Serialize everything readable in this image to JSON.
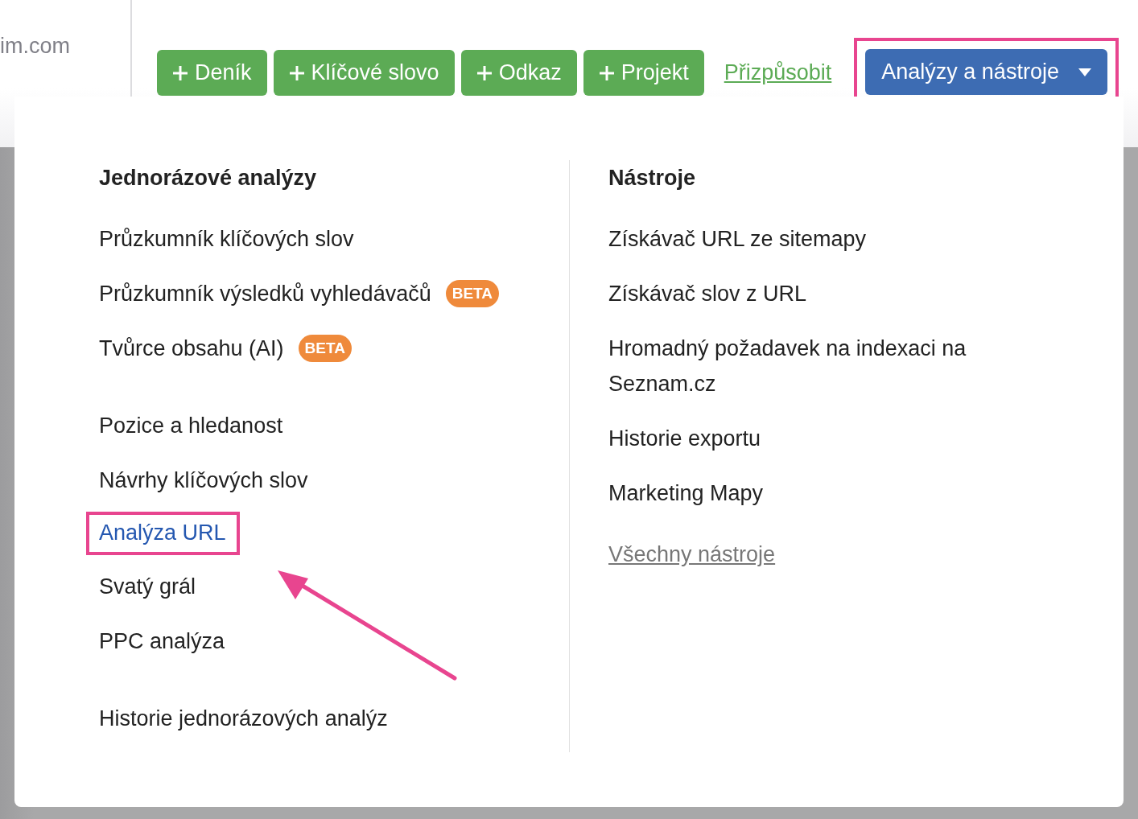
{
  "header": {
    "site_fragment": "im.com",
    "buttons": [
      {
        "label": "Deník"
      },
      {
        "label": "Klíčové slovo"
      },
      {
        "label": "Odkaz"
      },
      {
        "label": "Projekt"
      }
    ],
    "customize_link": "Přizpůsobit",
    "menu_button": {
      "label": "Analýzy a nástroje",
      "expanded": true,
      "highlighted": true
    }
  },
  "dropdown": {
    "columns": [
      {
        "heading": "Jednorázové analýzy",
        "groups": [
          [
            {
              "label": "Průzkumník klíčových slov",
              "selected": false
            },
            {
              "label": "Průzkumník výsledků vyhledávačů",
              "badge": "BETA",
              "selected": false
            },
            {
              "label": "Tvůrce obsahu (AI)",
              "badge": "BETA",
              "selected": false
            }
          ],
          [
            {
              "label": "Pozice a hledanost",
              "selected": false
            },
            {
              "label": "Návrhy klíčových slov",
              "selected": false
            },
            {
              "label": "Analýza URL",
              "selected": true,
              "highlighted": true
            },
            {
              "label": "Svatý grál",
              "selected": false
            },
            {
              "label": "PPC analýza",
              "selected": false
            }
          ],
          [
            {
              "label": "Historie jednorázových analýz",
              "selected": false
            }
          ]
        ]
      },
      {
        "heading": "Nástroje",
        "groups": [
          [
            {
              "label": "Získávač URL ze sitemapy",
              "selected": false
            },
            {
              "label": "Získávač slov z URL",
              "selected": false
            },
            {
              "label": "Hromadný požadavek na indexaci na Seznam.cz",
              "selected": false
            },
            {
              "label": "Historie exportu",
              "selected": false
            },
            {
              "label": "Marketing Mapy",
              "selected": false
            }
          ],
          [
            {
              "label": "Všechny nástroje",
              "kind": "link",
              "selected": false
            }
          ]
        ]
      }
    ]
  }
}
